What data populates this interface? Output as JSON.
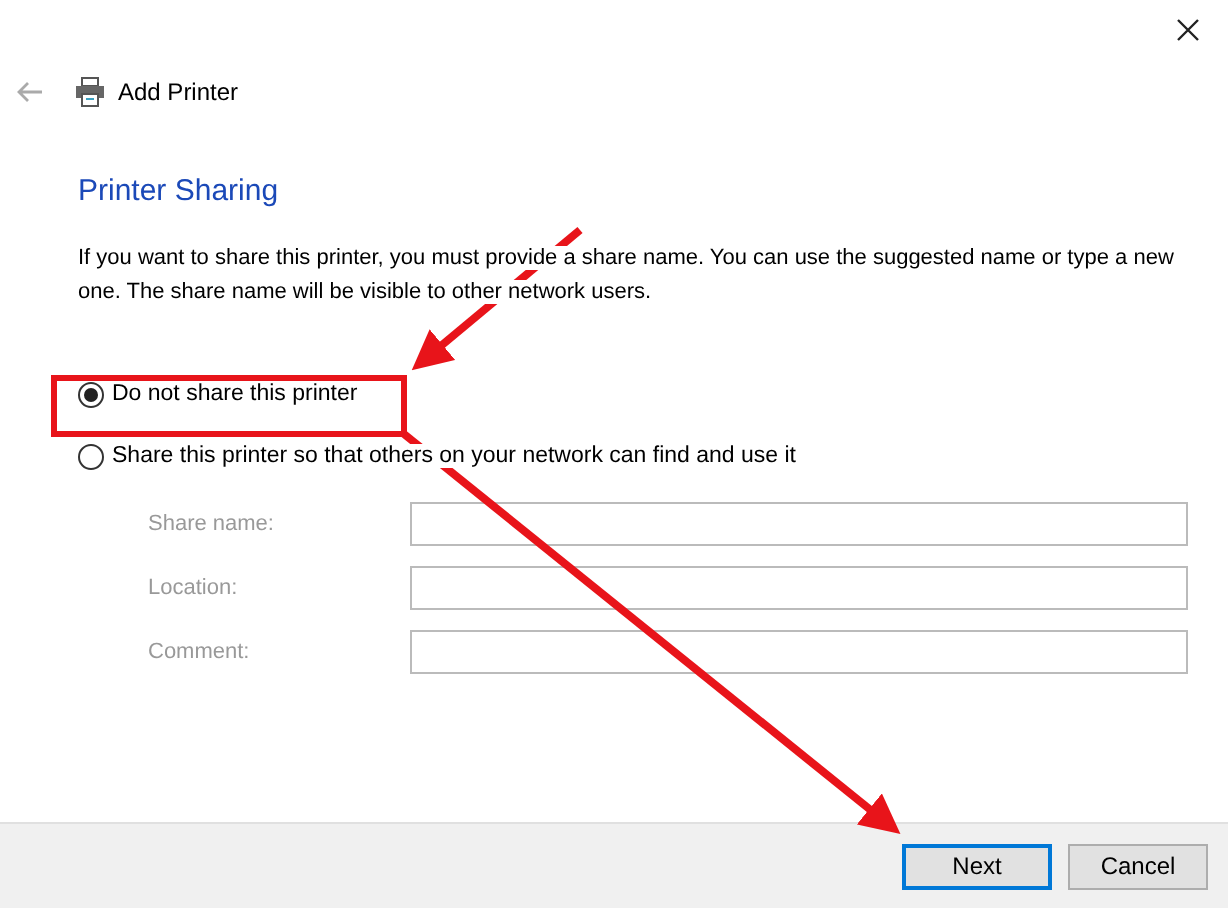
{
  "window": {
    "title": "Add Printer"
  },
  "heading": "Printer Sharing",
  "description": "If you want to share this printer, you must provide a share name. You can use the suggested name or type a new one. The share name will be visible to other network users.",
  "options": [
    {
      "label": "Do not share this printer",
      "selected": true
    },
    {
      "label": "Share this printer so that others on your network can find and use it",
      "selected": false
    }
  ],
  "fields": [
    {
      "label": "Share name:",
      "disabled": true
    },
    {
      "label": "Location:",
      "disabled": true
    },
    {
      "label": "Comment:",
      "disabled": true
    }
  ],
  "buttons": [
    {
      "label": "Next",
      "default": true
    },
    {
      "label": "Cancel",
      "default": false
    }
  ]
}
